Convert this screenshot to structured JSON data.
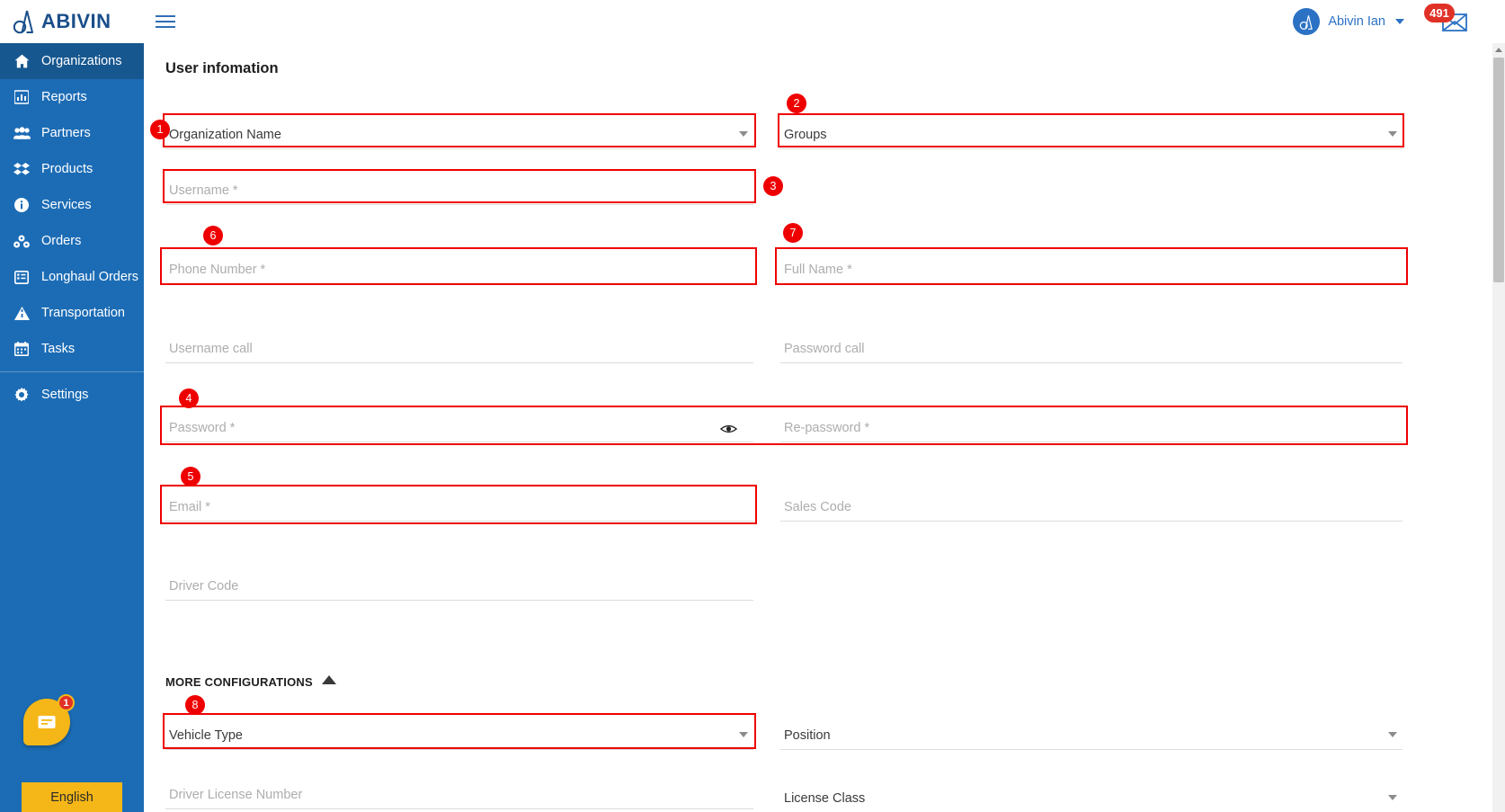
{
  "header": {
    "brand_name": "ABIVIN",
    "menu_icon": "hamburger-icon",
    "user_name": "Abivin Ian",
    "mail_badge_count": "491"
  },
  "sidebar": {
    "items": [
      {
        "label": "Organizations",
        "icon": "home-icon",
        "active": true
      },
      {
        "label": "Reports",
        "icon": "chart-bar-icon",
        "active": false
      },
      {
        "label": "Partners",
        "icon": "users-icon",
        "active": false
      },
      {
        "label": "Products",
        "icon": "boxes-icon",
        "active": false
      },
      {
        "label": "Services",
        "icon": "info-circle-icon",
        "active": false
      },
      {
        "label": "Orders",
        "icon": "orders-icon",
        "active": false
      },
      {
        "label": "Longhaul Orders",
        "icon": "list-table-icon",
        "active": false
      },
      {
        "label": "Transportation",
        "icon": "road-icon",
        "active": false
      },
      {
        "label": "Tasks",
        "icon": "calendar-icon",
        "active": false
      },
      {
        "label": "Settings",
        "icon": "gear-icon",
        "active": false
      }
    ],
    "chat": {
      "icon": "chat-bubble-icon",
      "badge": "1"
    },
    "language": {
      "label": "English"
    }
  },
  "main": {
    "title": "User infomation",
    "more_configurations_label": "MORE CONFIGURATIONS",
    "fields": {
      "organization_name": {
        "text": "Organization Name",
        "filled": true,
        "type": "select"
      },
      "groups": {
        "text": "Groups",
        "filled": true,
        "type": "select"
      },
      "username": {
        "text": "Username *",
        "filled": false,
        "type": "text"
      },
      "phone_number": {
        "text": "Phone Number *",
        "filled": false,
        "type": "text"
      },
      "full_name": {
        "text": "Full Name *",
        "filled": false,
        "type": "text"
      },
      "username_call": {
        "text": "Username call",
        "filled": false,
        "type": "text"
      },
      "password_call": {
        "text": "Password call",
        "filled": false,
        "type": "text"
      },
      "password": {
        "text": "Password *",
        "filled": false,
        "type": "password"
      },
      "re_password": {
        "text": "Re-password *",
        "filled": false,
        "type": "password"
      },
      "email": {
        "text": "Email *",
        "filled": false,
        "type": "text"
      },
      "sales_code": {
        "text": "Sales Code",
        "filled": false,
        "type": "text"
      },
      "driver_code": {
        "text": "Driver Code",
        "filled": false,
        "type": "text"
      },
      "vehicle_type": {
        "text": "Vehicle Type",
        "filled": true,
        "type": "select"
      },
      "position": {
        "text": "Position",
        "filled": true,
        "type": "select"
      },
      "driver_license_number": {
        "text": "Driver License Number",
        "filled": false,
        "type": "text"
      },
      "license_class": {
        "text": "License Class",
        "filled": true,
        "type": "select"
      }
    }
  },
  "annotations": {
    "markers": [
      {
        "number": "1",
        "target": "organization-name-field"
      },
      {
        "number": "2",
        "target": "groups-field"
      },
      {
        "number": "3",
        "target": "username-field"
      },
      {
        "number": "4",
        "target": "password-field"
      },
      {
        "number": "5",
        "target": "email-field"
      },
      {
        "number": "6",
        "target": "phone-number-field"
      },
      {
        "number": "7",
        "target": "full-name-field"
      },
      {
        "number": "8",
        "target": "vehicle-type-field"
      }
    ],
    "highlight_color": "#ef0000"
  }
}
